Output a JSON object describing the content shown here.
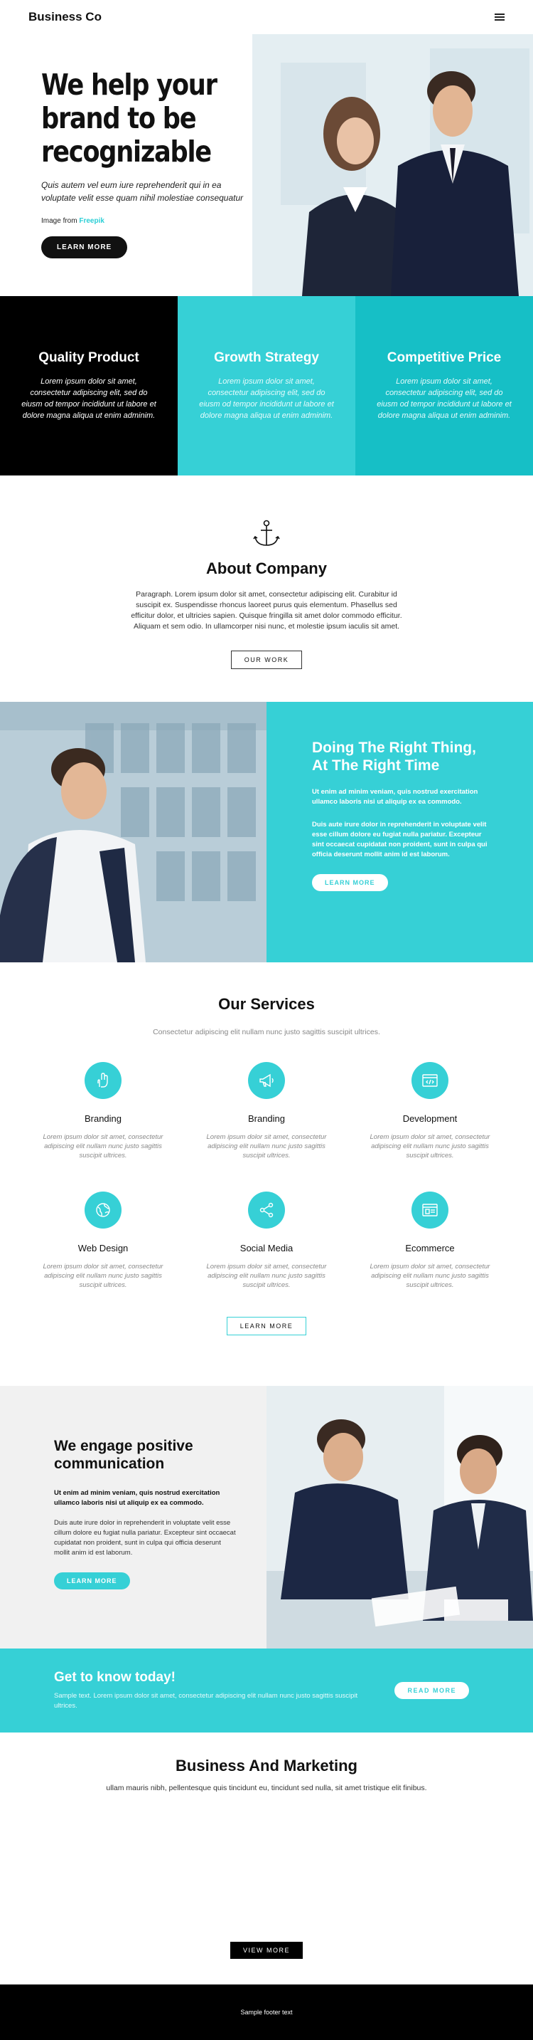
{
  "header": {
    "brand": "Business Co",
    "menu_icon": "hamburger-icon"
  },
  "hero": {
    "title": "We help your brand to be recognizable",
    "subtitle": "Quis autem vel eum iure reprehenderit qui in ea voluptate velit esse quam nihil molestiae consequatur",
    "credit_prefix": "Image from",
    "credit_link": "Freepik",
    "button": "LEARN MORE"
  },
  "features": [
    {
      "title": "Quality Product",
      "text": "Lorem ipsum dolor sit amet, consectetur adipiscing elit, sed do eiusm od tempor incididunt ut labore et dolore magna aliqua ut enim adminim."
    },
    {
      "title": "Growth Strategy",
      "text": "Lorem ipsum dolor sit amet, consectetur adipiscing elit, sed do eiusm od tempor incididunt ut labore et dolore magna aliqua ut enim adminim."
    },
    {
      "title": "Competitive Price",
      "text": "Lorem ipsum dolor sit amet, consectetur adipiscing elit, sed do eiusm od tempor incididunt ut labore et dolore magna aliqua ut enim adminim."
    }
  ],
  "about": {
    "icon": "anchor-icon",
    "title": "About Company",
    "text": "Paragraph. Lorem ipsum dolor sit amet, consectetur adipiscing elit. Curabitur id suscipit ex. Suspendisse rhoncus laoreet purus quis elementum. Phasellus sed efficitur dolor, et ultricies sapien. Quisque fringilla sit amet dolor commodo efficitur. Aliquam et sem odio. In ullamcorper nisi nunc, et molestie ipsum iaculis sit amet.",
    "button": "OUR WORK"
  },
  "right_thing": {
    "title": "Doing The Right Thing, At The Right Time",
    "p1": "Ut enim ad minim veniam, quis nostrud exercitation ullamco laboris nisi ut aliquip ex ea commodo.",
    "p2": "Duis aute irure dolor in reprehenderit in voluptate velit esse cillum dolore eu fugiat nulla pariatur. Excepteur sint occaecat cupidatat non proident, sunt in culpa qui officia deserunt mollit anim id est laborum.",
    "button": "LEARN MORE"
  },
  "services": {
    "title": "Our Services",
    "subtitle": "Consectetur adipiscing elit nullam nunc justo sagittis suscipit ultrices.",
    "items": [
      {
        "icon": "hand-icon",
        "title": "Branding",
        "text": "Lorem ipsum dolor sit amet, consectetur adipiscing elit nullam nunc justo sagittis suscipit ultrices."
      },
      {
        "icon": "megaphone-icon",
        "title": "Branding",
        "text": "Lorem ipsum dolor sit amet, consectetur adipiscing elit nullam nunc justo sagittis suscipit ultrices."
      },
      {
        "icon": "code-window-icon",
        "title": "Development",
        "text": "Lorem ipsum dolor sit amet, consectetur adipiscing elit nullam nunc justo sagittis suscipit ultrices."
      },
      {
        "icon": "globe-icon",
        "title": "Web Design",
        "text": "Lorem ipsum dolor sit amet, consectetur adipiscing elit nullam nunc justo sagittis suscipit ultrices."
      },
      {
        "icon": "share-icon",
        "title": "Social Media",
        "text": "Lorem ipsum dolor sit amet, consectetur adipiscing elit nullam nunc justo sagittis suscipit ultrices."
      },
      {
        "icon": "store-icon",
        "title": "Ecommerce",
        "text": "Lorem ipsum dolor sit amet, consectetur adipiscing elit nullam nunc justo sagittis suscipit ultrices."
      }
    ],
    "button": "LEARN MORE"
  },
  "engage": {
    "title": "We engage positive communication",
    "bold": "Ut enim ad minim veniam, quis nostrud exercitation ullamco laboris nisi ut aliquip ex ea commodo.",
    "text": "Duis aute irure dolor in reprehenderit in voluptate velit esse cillum dolore eu fugiat nulla pariatur. Excepteur sint occaecat cupidatat non proident, sunt in culpa qui officia deserunt mollit anim id est laborum.",
    "button": "LEARN MORE"
  },
  "cta": {
    "title": "Get to know today!",
    "text": "Sample text. Lorem ipsum dolor sit amet, consectetur adipiscing elit nullam nunc justo sagittis suscipit ultrices.",
    "button": "READ MORE"
  },
  "business": {
    "title": "Business And Marketing",
    "text": "ullam mauris nibh, pellentesque quis tincidunt eu, tincidunt sed nulla, sit amet tristique elit finibus.",
    "button": "VIEW MORE"
  },
  "footer": {
    "text": "Sample footer text"
  },
  "colors": {
    "accent": "#36d0d6",
    "accent_dark": "#16bfc6",
    "dark": "#000000"
  }
}
